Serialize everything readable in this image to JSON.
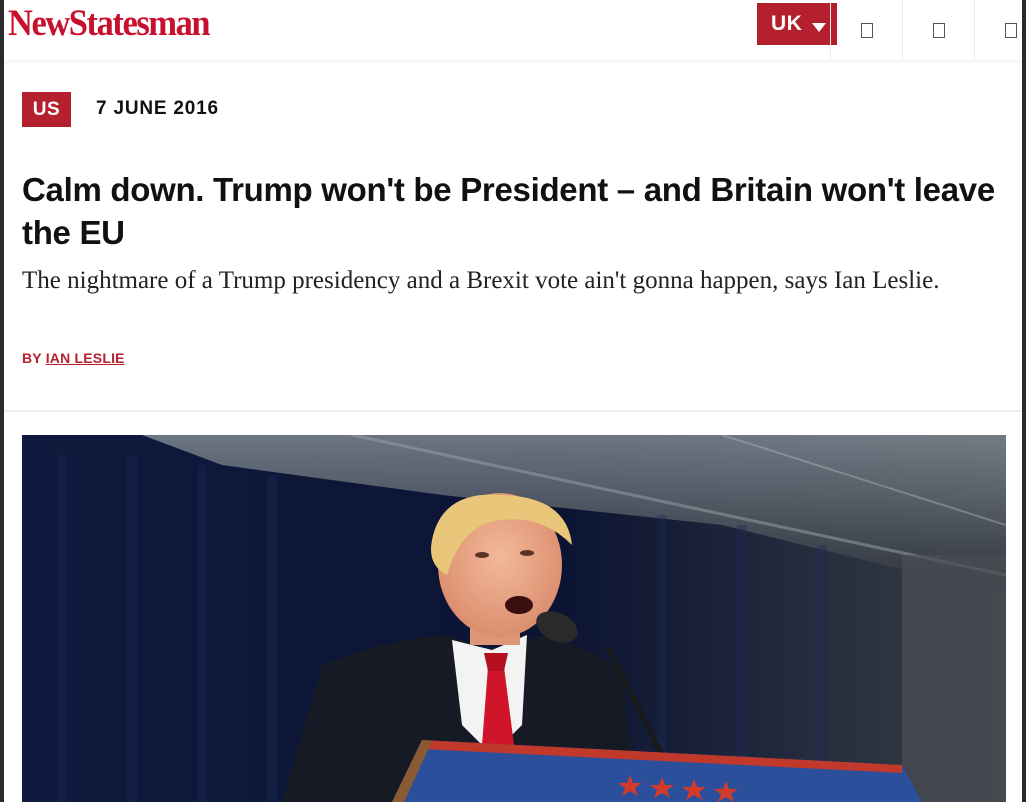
{
  "brand": {
    "logo_text": "NewStatesman",
    "color": "#c8102e"
  },
  "header": {
    "edition_label": "UK",
    "icons": [
      "search-icon",
      "user-icon",
      "menu-icon"
    ]
  },
  "article": {
    "section_tag": "US",
    "date": "7 JUNE 2016",
    "headline": "Calm down. Trump won't be President – and Britain won't leave the EU",
    "standfirst": "The nightmare of a Trump presidency and a Brexit vote ain't gonna happen, says Ian Leslie.",
    "byline_prefix": "BY",
    "author": "IAN LESLIE",
    "accent_color": "#b5202e"
  }
}
